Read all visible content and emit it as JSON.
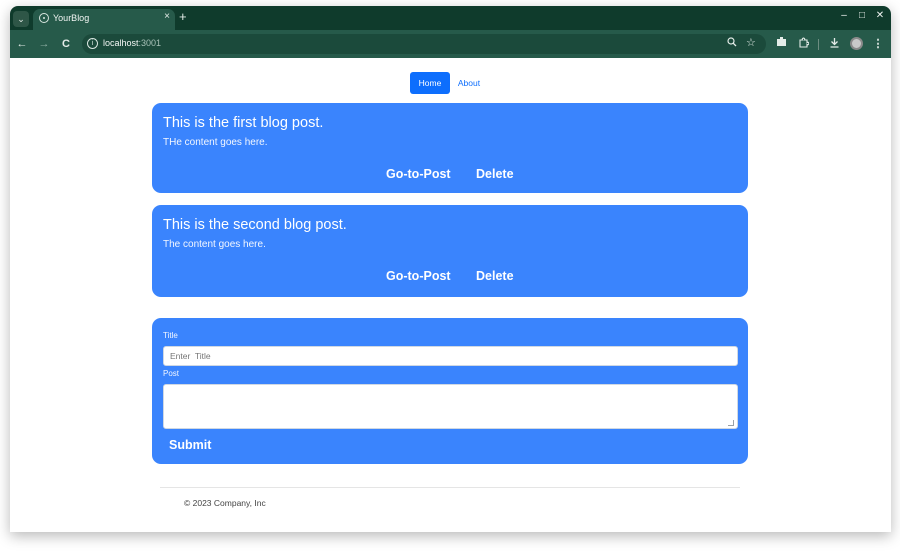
{
  "browser": {
    "tab_switcher_icon": "chevron-down-icon",
    "tab": {
      "title": "YourBlog",
      "close_symbol": "×"
    },
    "new_tab_symbol": "+",
    "window_controls": {
      "minimize": "–",
      "maximize": "□",
      "close": "✕"
    },
    "nav_icons": {
      "back": "←",
      "forward": "→",
      "reload": "C"
    },
    "address": {
      "host": "localhost",
      "port": ":3001"
    },
    "toolbar_icons": [
      "zoom-icon",
      "star-icon",
      "extension-puzzle-icon",
      "download-icon",
      "profile-avatar-icon",
      "menu-icon"
    ]
  },
  "nav": {
    "home": "Home",
    "about": "About"
  },
  "posts": [
    {
      "title": "This is the first blog post.",
      "content": "THe content goes here.",
      "go_label": "Go-to-Post",
      "delete_label": "Delete"
    },
    {
      "title": "This is the second blog post.",
      "content": "The content goes here.",
      "go_label": "Go-to-Post",
      "delete_label": "Delete"
    }
  ],
  "form": {
    "title_label": "Title",
    "title_placeholder": "Enter  Title",
    "title_value": "",
    "post_label": "Post",
    "post_value": "",
    "submit_label": "Submit"
  },
  "footer": {
    "text": "© 2023 Company, Inc"
  },
  "colors": {
    "card": "#3a84fd",
    "nav_active": "#0d6efd",
    "browser_frame": "#0f3b2c",
    "toolbar": "#265a4a"
  }
}
